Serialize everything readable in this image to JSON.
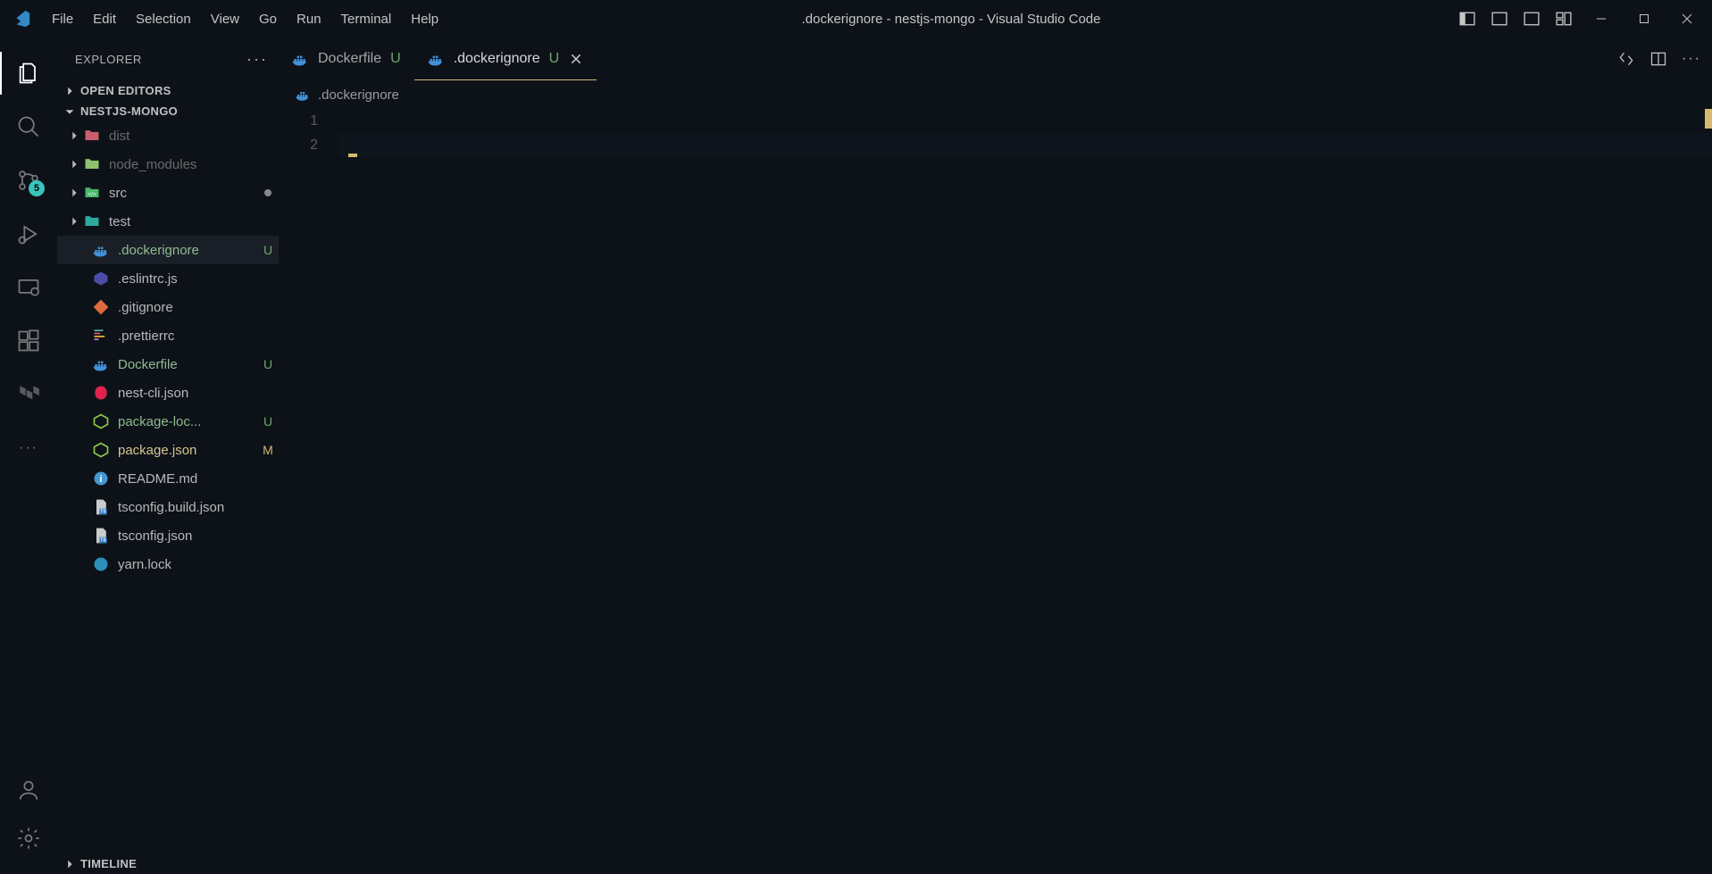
{
  "titlebar": {
    "title": ".dockerignore - nestjs-mongo - Visual Studio Code"
  },
  "menu": {
    "items": [
      "File",
      "Edit",
      "Selection",
      "View",
      "Go",
      "Run",
      "Terminal",
      "Help"
    ]
  },
  "activity_bar": {
    "scm_badge": "5"
  },
  "sidebar": {
    "title": "EXPLORER",
    "sections": {
      "open_editors": "OPEN EDITORS",
      "project": "NESTJS-MONGO",
      "timeline": "TIMELINE"
    },
    "tree": [
      {
        "name": "dist",
        "type": "folder",
        "dimmed": true,
        "icon": "folder-red",
        "status": ""
      },
      {
        "name": "node_modules",
        "type": "folder",
        "dimmed": true,
        "icon": "folder-green",
        "status": ""
      },
      {
        "name": "src",
        "type": "folder",
        "dimmed": false,
        "icon": "folder-src",
        "status": "dot"
      },
      {
        "name": "test",
        "type": "folder",
        "dimmed": false,
        "icon": "folder-test",
        "status": ""
      },
      {
        "name": ".dockerignore",
        "type": "file",
        "icon": "docker",
        "status": "U",
        "selected": true
      },
      {
        "name": ".eslintrc.js",
        "type": "file",
        "icon": "eslint",
        "status": ""
      },
      {
        "name": ".gitignore",
        "type": "file",
        "icon": "git",
        "status": ""
      },
      {
        "name": ".prettierrc",
        "type": "file",
        "icon": "prettier",
        "status": ""
      },
      {
        "name": "Dockerfile",
        "type": "file",
        "icon": "docker",
        "status": "U"
      },
      {
        "name": "nest-cli.json",
        "type": "file",
        "icon": "nest",
        "status": ""
      },
      {
        "name": "package-loc...",
        "type": "file",
        "icon": "node",
        "status": "U"
      },
      {
        "name": "package.json",
        "type": "file",
        "icon": "node",
        "status": "M"
      },
      {
        "name": "README.md",
        "type": "file",
        "icon": "info",
        "status": ""
      },
      {
        "name": "tsconfig.build.json",
        "type": "file",
        "icon": "tsconfig",
        "status": ""
      },
      {
        "name": "tsconfig.json",
        "type": "file",
        "icon": "tsconfig",
        "status": ""
      },
      {
        "name": "yarn.lock",
        "type": "file",
        "icon": "yarn",
        "status": ""
      }
    ]
  },
  "tabs": [
    {
      "label": "Dockerfile",
      "status": "U",
      "active": false
    },
    {
      "label": ".dockerignore",
      "status": "U",
      "active": true
    }
  ],
  "breadcrumb": {
    "file": ".dockerignore"
  },
  "editor": {
    "lines": [
      "1",
      "2"
    ]
  }
}
